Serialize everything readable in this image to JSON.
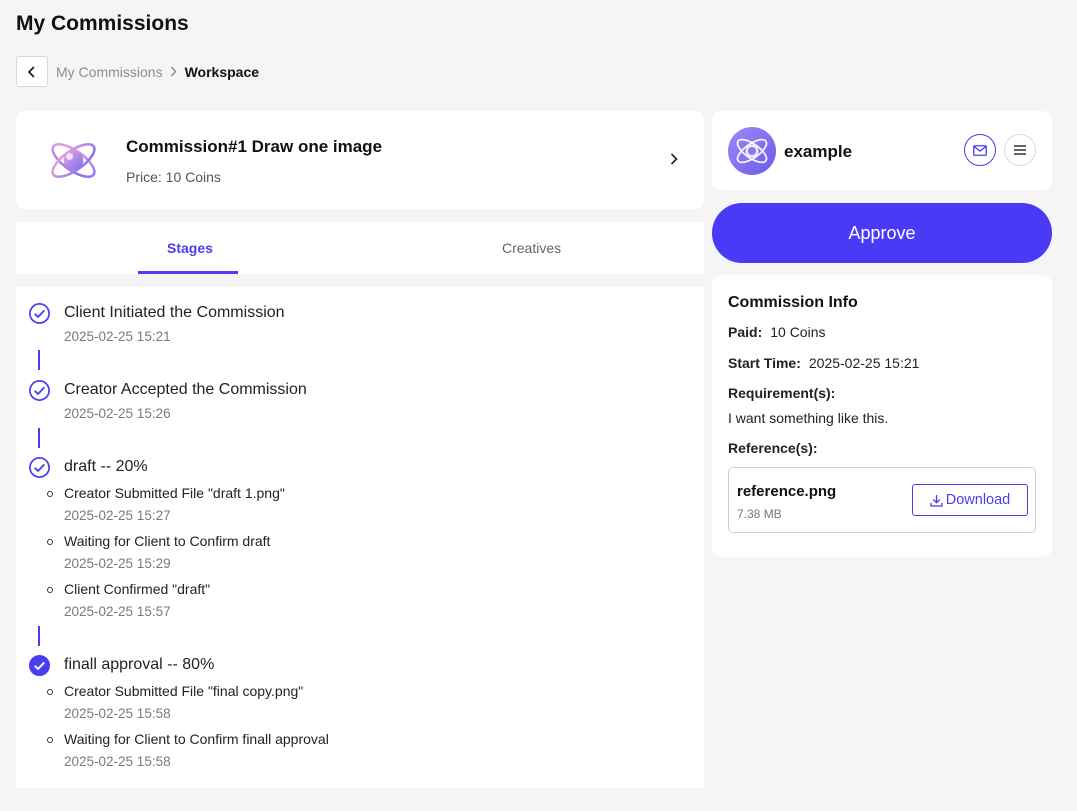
{
  "page": {
    "title": "My Commissions"
  },
  "breadcrumb": {
    "parent": "My Commissions",
    "current": "Workspace"
  },
  "commission": {
    "title": "Commission#1 Draw one image",
    "price": "Price: 10 Coins"
  },
  "tabs": [
    {
      "label": "Stages",
      "active": true
    },
    {
      "label": "Creatives",
      "active": false
    }
  ],
  "stages": [
    {
      "title": "Client Initiated the Commission",
      "time": "2025-02-25 15:21",
      "state": "done"
    },
    {
      "title": "Creator Accepted the Commission",
      "time": "2025-02-25 15:26",
      "state": "done"
    },
    {
      "title": "draft -- 20%",
      "state": "done",
      "events": [
        {
          "title": "Creator Submitted File \"draft 1.png\"",
          "time": "2025-02-25 15:27"
        },
        {
          "title": "Waiting for Client to Confirm draft",
          "time": "2025-02-25 15:29"
        },
        {
          "title": "Client Confirmed \"draft\"",
          "time": "2025-02-25 15:57"
        }
      ]
    },
    {
      "title": "finall approval -- 80%",
      "state": "current",
      "events": [
        {
          "title": "Creator Submitted File \"final copy.png\"",
          "time": "2025-02-25 15:58"
        },
        {
          "title": "Waiting for Client to Confirm finall approval",
          "time": "2025-02-25 15:58"
        }
      ]
    }
  ],
  "user": {
    "name": "example",
    "avatar_icon": "atom-logo-icon"
  },
  "actions": {
    "approve_label": "Approve"
  },
  "info": {
    "heading": "Commission Info",
    "paid_label": "Paid:",
    "paid_value": "10 Coins",
    "start_label": "Start Time:",
    "start_value": "2025-02-25 15:21",
    "requirements_label": "Requirement(s):",
    "requirements_value": "I want something like this.",
    "references_label": "Reference(s):",
    "reference": {
      "name": "reference.png",
      "size": "7.38 MB",
      "download_label": "Download"
    }
  },
  "colors": {
    "accent": "#4b3df0",
    "approve_bg": "#4a3af8",
    "page_bg": "#f5f5f5"
  }
}
